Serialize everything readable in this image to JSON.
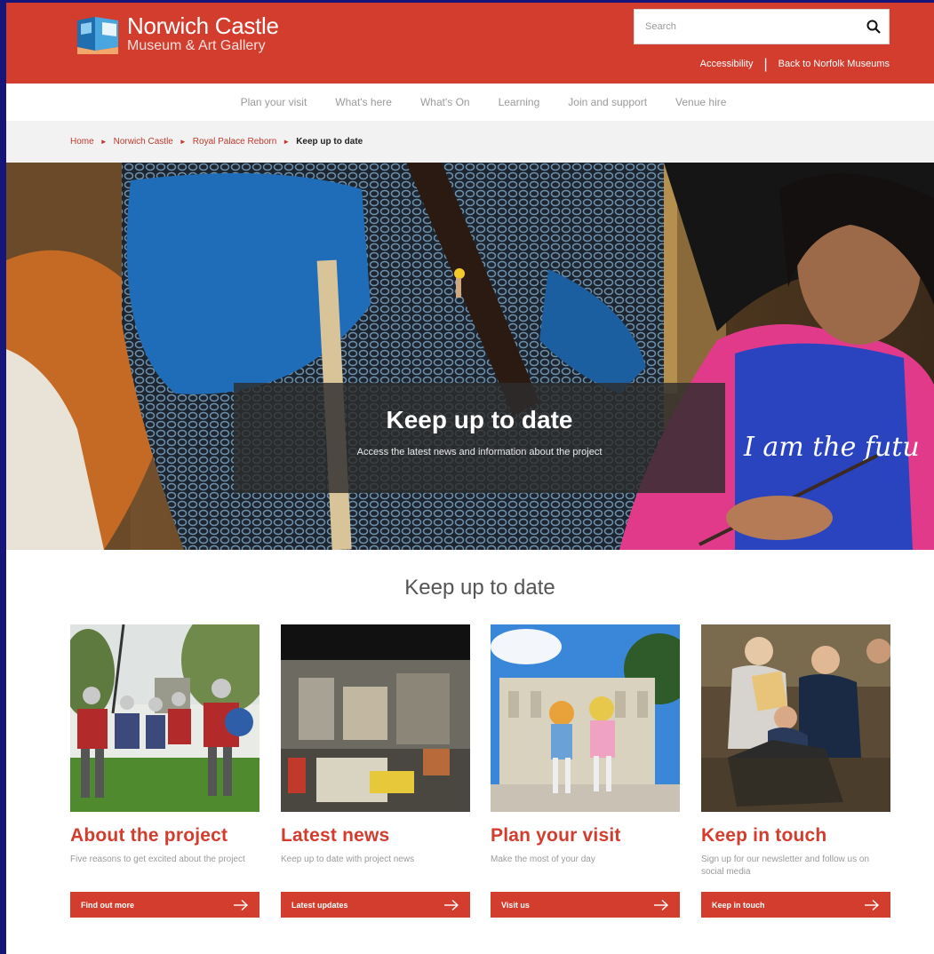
{
  "header": {
    "logo_line1": "Norwich Castle",
    "logo_line2": "Museum & Art Gallery",
    "search_placeholder": "Search",
    "accessibility_link": "Accessibility",
    "separator": "|",
    "back_link": "Back to Norfolk Museums"
  },
  "nav": {
    "items": [
      {
        "label": "Plan your visit"
      },
      {
        "label": "What's here"
      },
      {
        "label": "What's On"
      },
      {
        "label": "Learning"
      },
      {
        "label": "Join and support"
      },
      {
        "label": "Venue hire"
      }
    ]
  },
  "breadcrumb": {
    "items": [
      {
        "label": "Home"
      },
      {
        "label": "Norwich Castle"
      },
      {
        "label": "Royal Palace Reborn"
      }
    ],
    "separator": "►",
    "current": "Keep up to date"
  },
  "hero": {
    "title": "Keep up to date",
    "subtitle": "Access the latest news and information about the project",
    "tshirt_text": "I am the futu"
  },
  "section": {
    "title": "Keep up to date"
  },
  "cards": [
    {
      "title": "About the project",
      "description": "Five reasons to get excited about the project",
      "button": "Find out more"
    },
    {
      "title": "Latest news",
      "description": "Keep up to date with project news",
      "button": "Latest updates"
    },
    {
      "title": "Plan your visit",
      "description": "Make the most of your day",
      "button": "Visit us"
    },
    {
      "title": "Keep in touch",
      "description": "Sign up for our newsletter and follow us on social media",
      "button": "Keep in touch"
    }
  ],
  "colors": {
    "brand_red": "#d23d2e",
    "frame_blue": "#15157a",
    "breadcrumb_bg": "#f2f2f2",
    "muted_text": "#9a9a9a"
  },
  "icons": {
    "logo": "castle-logo-icon",
    "search": "search-icon",
    "breadcrumb_separator": "triangle-right-icon",
    "button_arrow": "arrow-right-icon"
  }
}
